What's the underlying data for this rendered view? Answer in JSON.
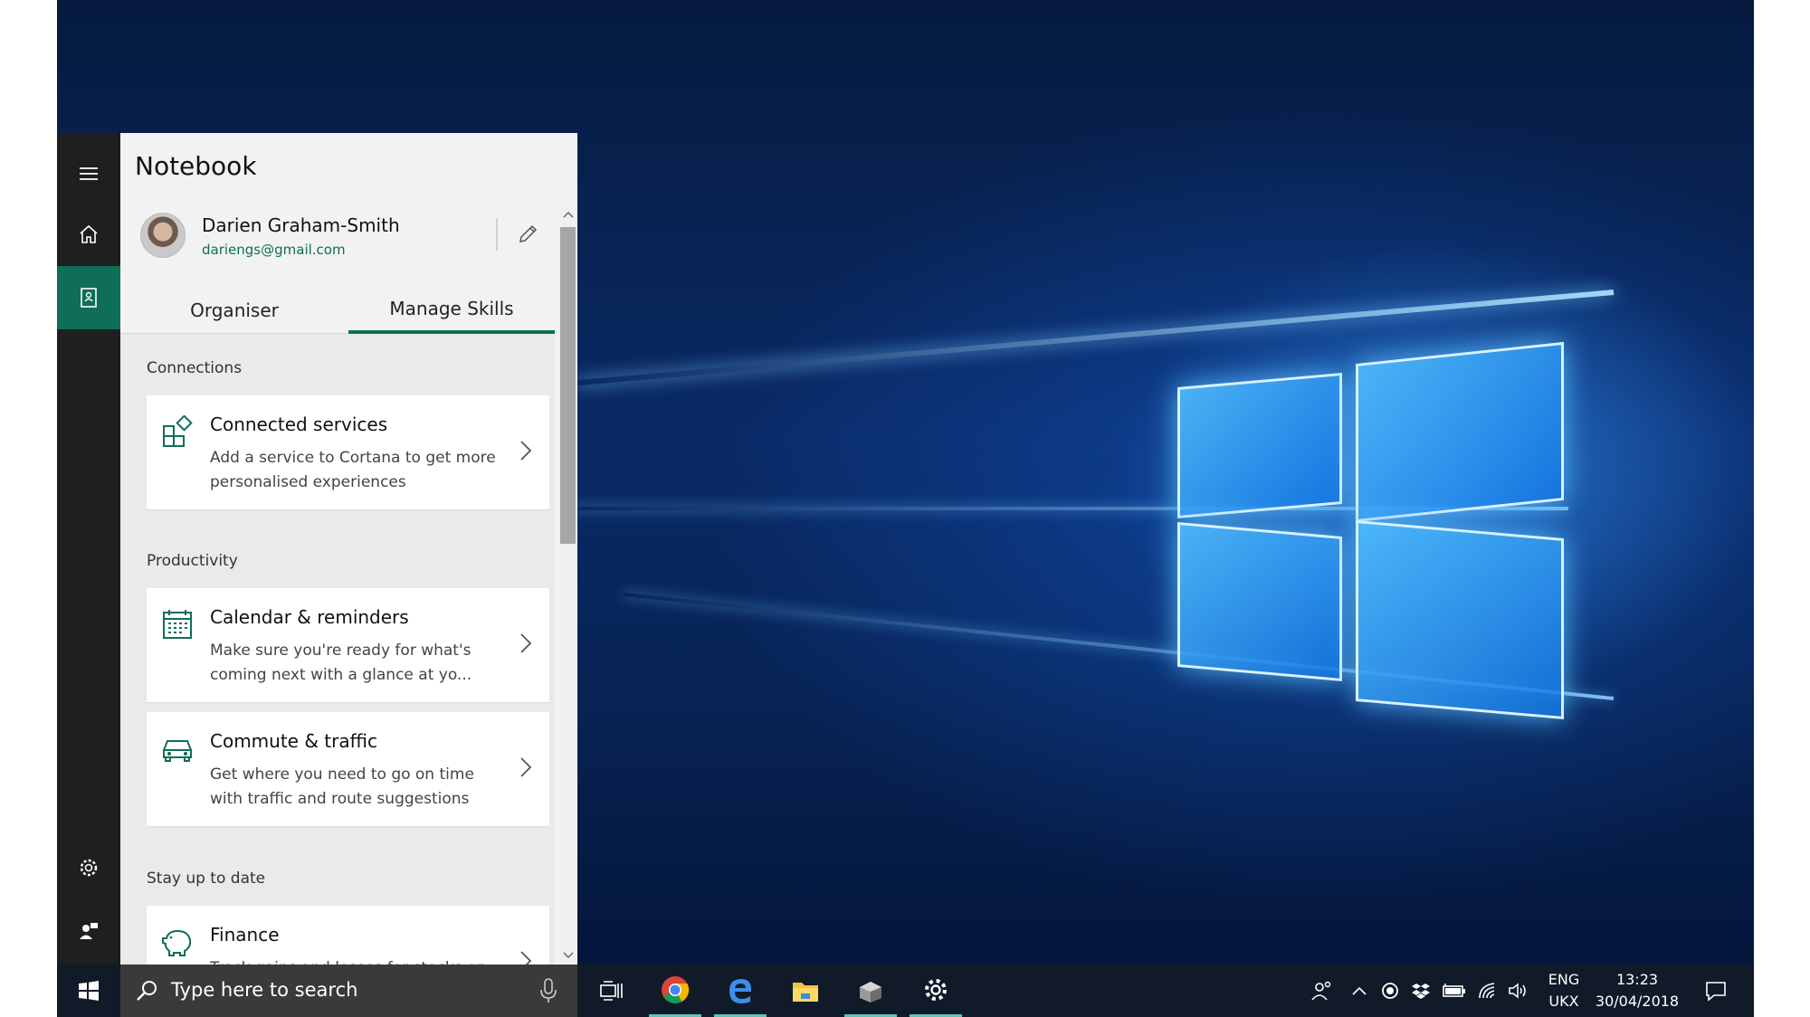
{
  "cortana": {
    "panel_title": "Notebook",
    "profile": {
      "name": "Darien Graham-Smith",
      "email": "dariengs@gmail.com"
    },
    "tabs": [
      {
        "label": "Organiser",
        "active": false
      },
      {
        "label": "Manage Skills",
        "active": true
      }
    ],
    "sections": [
      {
        "heading": "Connections",
        "cards": [
          {
            "icon": "connected-services-icon",
            "title": "Connected services",
            "desc": "Add a service to Cortana to get more personalised experiences"
          }
        ]
      },
      {
        "heading": "Productivity",
        "cards": [
          {
            "icon": "calendar-icon",
            "title": "Calendar & reminders",
            "desc": "Make sure you're ready for what's coming next with a glance at yo..."
          },
          {
            "icon": "car-icon",
            "title": "Commute & traffic",
            "desc": "Get where you need to go on time with traffic and route suggestions"
          }
        ]
      },
      {
        "heading": "Stay up to date",
        "cards": [
          {
            "icon": "piggy-bank-icon",
            "title": "Finance",
            "desc": "Track gains and losses for stocks on"
          }
        ]
      }
    ],
    "accent_color": "#0f6e58"
  },
  "taskbar": {
    "search_placeholder": "Type here to search",
    "pinned": [
      "task-view-icon",
      "chrome-icon",
      "edge-icon",
      "file-explorer-icon",
      "app-icon",
      "settings-icon"
    ],
    "language": {
      "line1": "ENG",
      "line2": "UKX"
    },
    "clock": {
      "time": "13:23",
      "date": "30/04/2018"
    }
  }
}
